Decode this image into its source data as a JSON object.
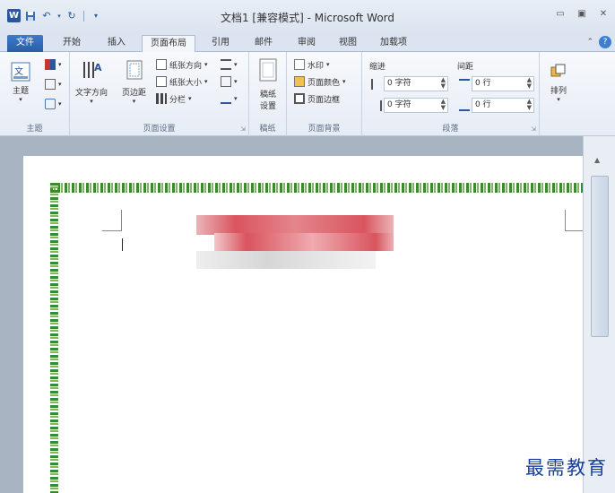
{
  "window": {
    "title": "文档1 [兼容模式] - Microsoft Word",
    "app_icon_letter": "W",
    "controls": [
      "▭",
      "▣",
      "✕"
    ]
  },
  "quick_access": [
    "save-icon",
    "undo-icon",
    "redo-icon",
    "customize-icon"
  ],
  "tabs": [
    {
      "label": "文件"
    },
    {
      "label": "开始"
    },
    {
      "label": "插入"
    },
    {
      "label": "页面布局"
    },
    {
      "label": "引用"
    },
    {
      "label": "邮件"
    },
    {
      "label": "审阅"
    },
    {
      "label": "视图"
    },
    {
      "label": "加载项"
    }
  ],
  "active_tab": "页面布局",
  "ribbon": {
    "themes": {
      "group_label": "主题",
      "theme_button": "主题"
    },
    "page_setup": {
      "group_label": "页面设置",
      "text_direction": "文字方向",
      "margins": "页边距",
      "orientation": "纸张方向",
      "size": "纸张大小",
      "columns": "分栏"
    },
    "draft": {
      "group_label": "稿纸",
      "button_line1": "稿纸",
      "button_line2": "设置"
    },
    "page_background": {
      "group_label": "页面背景",
      "watermark": "水印",
      "page_color": "页面颜色",
      "page_borders": "页面边框"
    },
    "paragraph": {
      "group_label": "段落",
      "indent_header": "缩进",
      "spacing_header": "间距",
      "indent_left": "0 字符",
      "indent_right": "0 字符",
      "spacing_before": "0 行",
      "spacing_after": "0 行"
    },
    "arrange": {
      "label": "排列"
    }
  },
  "colors": {
    "file_tab": "#2a5ea6",
    "page_border": "#3a8a32",
    "watermark_text": "#1a3f9a",
    "blur_red": "#d9545e"
  },
  "watermark_text": "最需教育"
}
